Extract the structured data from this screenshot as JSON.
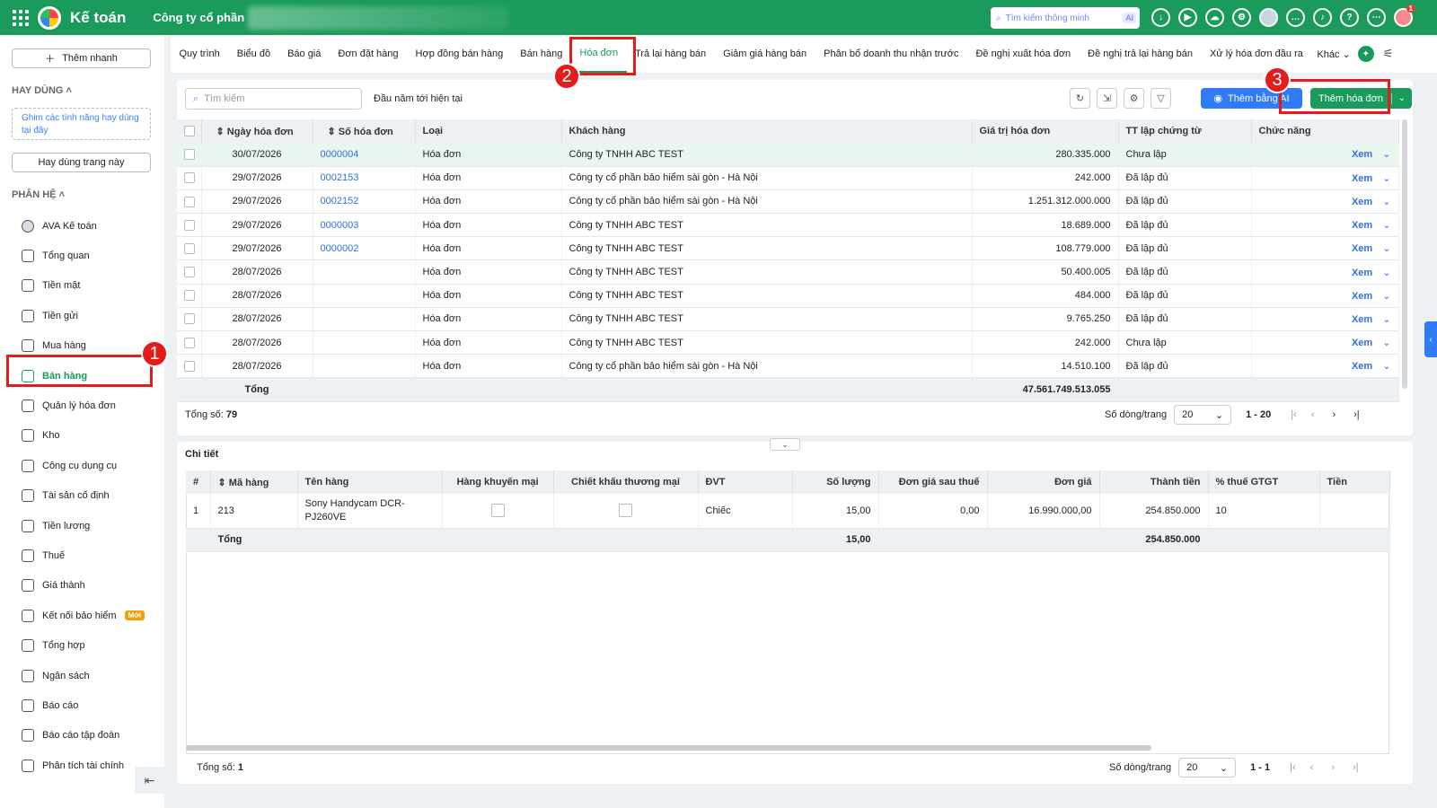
{
  "top": {
    "app_name": "Kế toán",
    "company": "Công ty cổ phần",
    "search_placeholder": "Tìm kiếm thông minh",
    "search_ai": "AI",
    "notif_count": "1"
  },
  "sidebar": {
    "quick_add": "Thêm nhanh",
    "frequent_title": "HAY DÙNG",
    "pin_hint": "Ghim các tính năng hay dùng tại đây",
    "use_page": "Hay dùng trang này",
    "system_title": "PHÂN HỆ",
    "items": [
      {
        "label": "AVA Kế toán",
        "icon": "ava-icon"
      },
      {
        "label": "Tổng quan",
        "icon": "dashboard-icon"
      },
      {
        "label": "Tiền mặt",
        "icon": "cash-icon"
      },
      {
        "label": "Tiền gửi",
        "icon": "bank-icon"
      },
      {
        "label": "Mua hàng",
        "icon": "bag-icon"
      },
      {
        "label": "Bán hàng",
        "icon": "cart-icon"
      },
      {
        "label": "Quản lý hóa đơn",
        "icon": "invoice-icon"
      },
      {
        "label": "Kho",
        "icon": "warehouse-icon"
      },
      {
        "label": "Công cụ dụng cụ",
        "icon": "tools-icon"
      },
      {
        "label": "Tài sản cố định",
        "icon": "car-icon"
      },
      {
        "label": "Tiền lương",
        "icon": "salary-icon"
      },
      {
        "label": "Thuế",
        "icon": "tax-icon"
      },
      {
        "label": "Giá thành",
        "icon": "price-tag-icon"
      },
      {
        "label": "Kết nối bảo hiểm",
        "icon": "insurance-icon",
        "badge": "Mới"
      },
      {
        "label": "Tổng hợp",
        "icon": "summary-icon"
      },
      {
        "label": "Ngân sách",
        "icon": "budget-icon"
      },
      {
        "label": "Báo cáo",
        "icon": "report-icon"
      },
      {
        "label": "Báo cáo tập đoàn",
        "icon": "group-report-icon"
      },
      {
        "label": "Phân tích tài chính",
        "icon": "analysis-icon"
      }
    ]
  },
  "tabs": [
    "Quy trình",
    "Biểu đồ",
    "Báo giá",
    "Đơn đặt hàng",
    "Hợp đồng bán hàng",
    "Bán hàng",
    "Hóa đơn",
    "Trả lại hàng bán",
    "Giảm giá hàng bán",
    "Phân bổ doanh thu nhận trước",
    "Đề nghị xuất hóa đơn",
    "Đề nghị trả lại hàng bán",
    "Xử lý hóa đơn đầu ra"
  ],
  "tab_more": "Khác",
  "toolbar": {
    "search_placeholder": "Tìm kiếm",
    "period": "Đầu năm tới hiện tại",
    "ai_button": "Thêm bằng AI",
    "add_button": "Thêm hóa đơn"
  },
  "invoice_table": {
    "headers": [
      "Ngày hóa đơn",
      "Số hóa đơn",
      "Loại",
      "Khách hàng",
      "Giá trị hóa đơn",
      "TT lập chứng từ",
      "Chức năng"
    ],
    "rows": [
      [
        "30/07/2026",
        "0000004",
        "Hóa đơn",
        "Công ty TNHH ABC TEST",
        "280.335.000",
        "Chưa lập",
        "Xem"
      ],
      [
        "29/07/2026",
        "0002153",
        "Hóa đơn",
        "Công ty cổ phần bảo hiểm sài gòn - Hà Nội",
        "242.000",
        "Đã lập đủ",
        "Xem"
      ],
      [
        "29/07/2026",
        "0002152",
        "Hóa đơn",
        "Công ty cổ phần bảo hiểm sài gòn - Hà Nội",
        "1.251.312.000.000",
        "Đã lập đủ",
        "Xem"
      ],
      [
        "29/07/2026",
        "0000003",
        "Hóa đơn",
        "Công ty TNHH ABC TEST",
        "18.689.000",
        "Đã lập đủ",
        "Xem"
      ],
      [
        "29/07/2026",
        "0000002",
        "Hóa đơn",
        "Công ty TNHH ABC TEST",
        "108.779.000",
        "Đã lập đủ",
        "Xem"
      ],
      [
        "28/07/2026",
        "",
        "Hóa đơn",
        "Công ty TNHH ABC TEST",
        "50.400.005",
        "Đã lập đủ",
        "Xem"
      ],
      [
        "28/07/2026",
        "",
        "Hóa đơn",
        "Công ty TNHH ABC TEST",
        "484.000",
        "Đã lập đủ",
        "Xem"
      ],
      [
        "28/07/2026",
        "",
        "Hóa đơn",
        "Công ty TNHH ABC TEST",
        "9.765.250",
        "Đã lập đủ",
        "Xem"
      ],
      [
        "28/07/2026",
        "",
        "Hóa đơn",
        "Công ty TNHH ABC TEST",
        "242.000",
        "Chưa lập",
        "Xem"
      ],
      [
        "28/07/2026",
        "",
        "Hóa đơn",
        "Công ty cổ phần bảo hiểm sài gòn - Hà Nội",
        "14.510.100",
        "Đã lập đủ",
        "Xem"
      ]
    ],
    "total_label": "Tổng",
    "total_value": "47.561.749.513.055",
    "count_label": "Tổng số:",
    "count": "79",
    "rows_per_page_label": "Số dòng/trang",
    "rows_per_page": "20",
    "range": "1 - 20"
  },
  "detail": {
    "title": "Chi tiết",
    "headers": [
      "#",
      "Mã hàng",
      "Tên hàng",
      "Hàng khuyến mại",
      "Chiết khấu thương mại",
      "ĐVT",
      "Số lượng",
      "Đơn giá sau thuế",
      "Đơn giá",
      "Thành tiền",
      "% thuế GTGT",
      "Tiền"
    ],
    "row": [
      "1",
      "213",
      "Sony Handycam DCR-PJ260VE",
      "",
      "",
      "Chiếc",
      "15,00",
      "0,00",
      "16.990.000,00",
      "254.850.000",
      "10",
      ""
    ],
    "total_label": "Tổng",
    "total_qty": "15,00",
    "total_amount": "254.850.000",
    "count_label": "Tổng số:",
    "count": "1",
    "rows_per_page_label": "Số dòng/trang",
    "rows_per_page": "20",
    "range": "1 - 1"
  },
  "annotations": [
    "1",
    "2",
    "3"
  ],
  "colors": {
    "brand": "#1a9b5b",
    "highlight": "#e31b1b",
    "link": "#2f6fe0",
    "ai": "#2f7cf6"
  }
}
